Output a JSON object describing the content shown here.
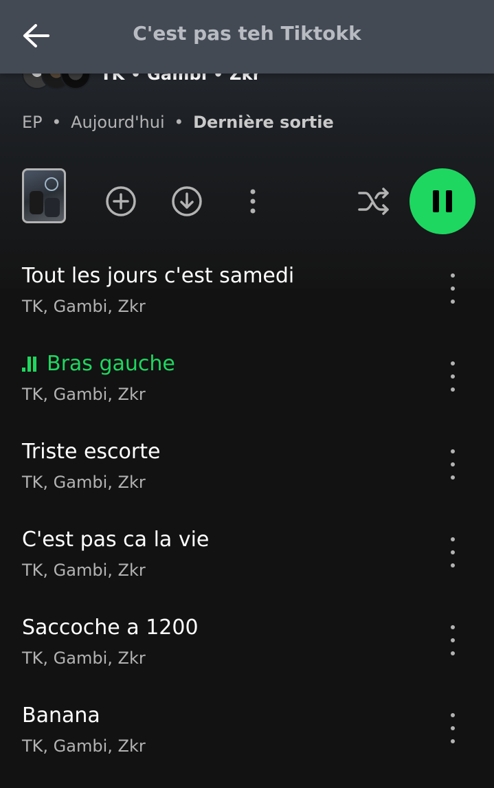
{
  "header": {
    "title": "C'est pas teh Tiktokk",
    "back_icon": "arrow-left-icon"
  },
  "artists": {
    "names": "TK • Gambi • Zkr"
  },
  "meta": {
    "type": "EP",
    "date": "Aujourd'hui",
    "badge": "Dernière sortie",
    "separator": "•"
  },
  "actions": {
    "add_icon": "add-circle-icon",
    "download_icon": "download-circle-icon",
    "more_icon": "more-vertical-icon",
    "shuffle_icon": "shuffle-icon",
    "play_state_icon": "pause-icon"
  },
  "colors": {
    "accent": "#1ed760",
    "background": "#121212",
    "header": "#444a54",
    "secondary_text": "#b3b3b3"
  },
  "tracks": [
    {
      "title": "Tout les jours c'est samedi",
      "artists": "TK, Gambi, Zkr",
      "playing": false
    },
    {
      "title": "Bras gauche",
      "artists": "TK, Gambi, Zkr",
      "playing": true
    },
    {
      "title": "Triste escorte",
      "artists": "TK, Gambi, Zkr",
      "playing": false
    },
    {
      "title": "C'est pas ca la vie",
      "artists": "TK, Gambi, Zkr",
      "playing": false
    },
    {
      "title": "Saccoche a 1200",
      "artists": "TK, Gambi, Zkr",
      "playing": false
    },
    {
      "title": "Banana",
      "artists": "TK, Gambi, Zkr",
      "playing": false
    }
  ]
}
